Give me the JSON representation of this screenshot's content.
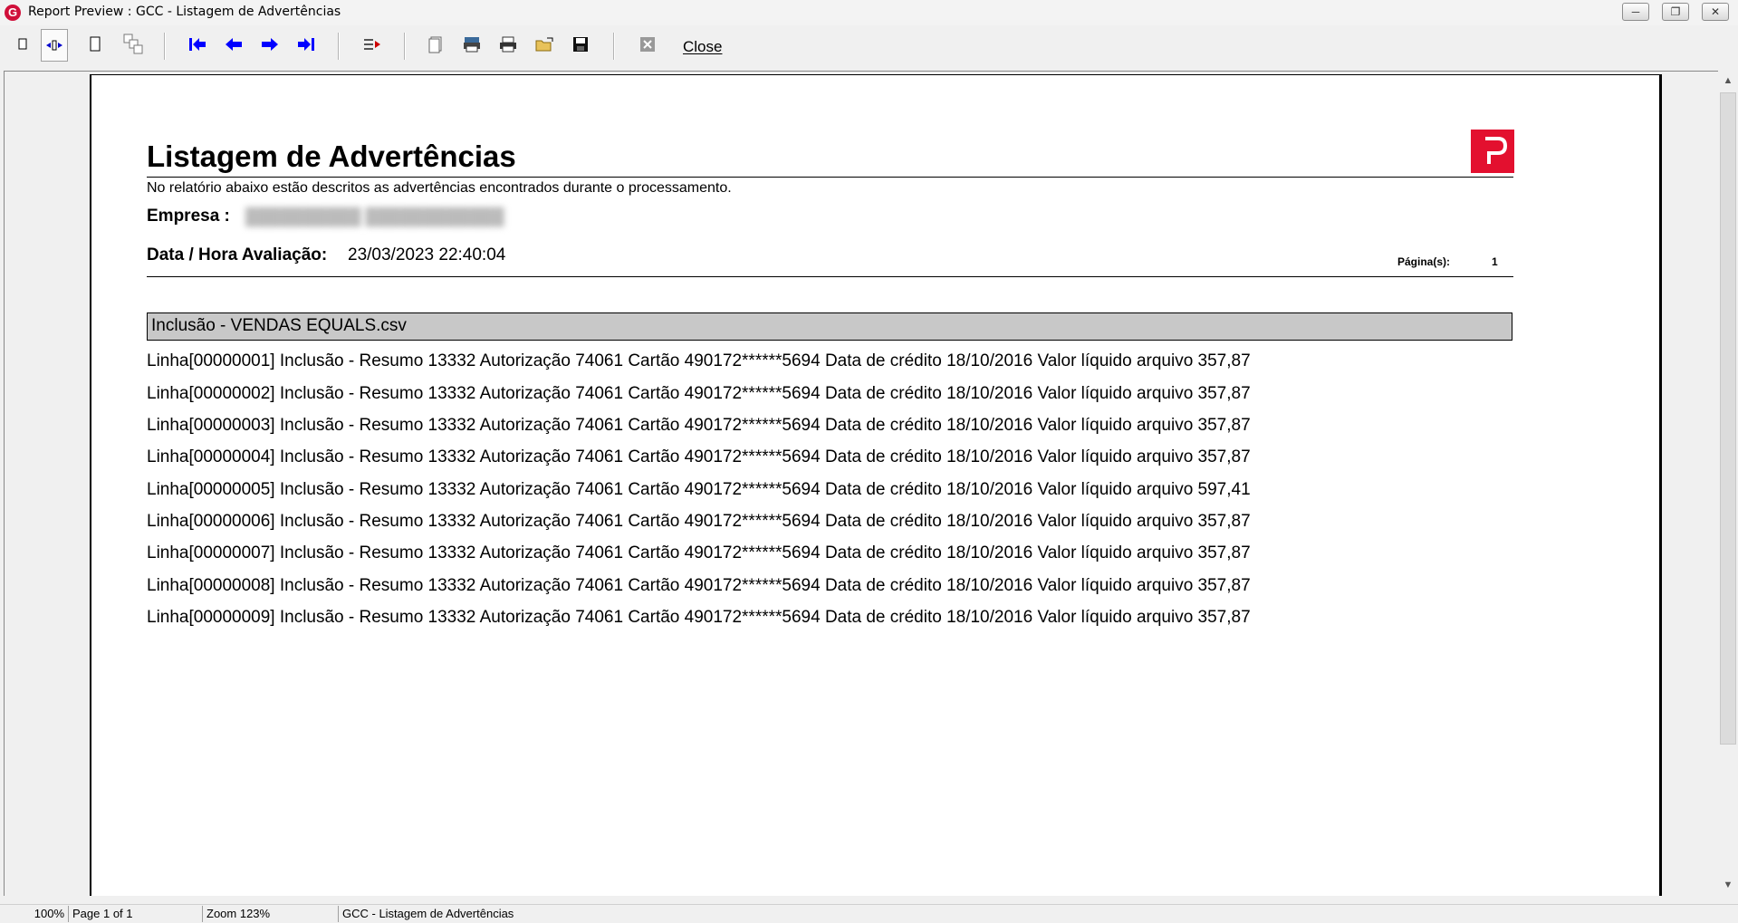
{
  "window": {
    "title": "Report Preview : GCC - Listagem de Advertências",
    "app_icon": "G"
  },
  "toolbar": {
    "buttons": [
      "zoom-to-fit-icon",
      "zoom-100-icon",
      "zoom-to-width-icon",
      "pages-icon",
      "first-page-icon",
      "previous-page-icon",
      "next-page-icon",
      "last-page-icon",
      "goto-page-icon",
      "page-setup-icon",
      "printer-setup-icon",
      "print-icon",
      "open-icon",
      "save-icon",
      "export-icon"
    ],
    "close_label": "Close",
    "nav_arrow_color": "#0000ff"
  },
  "report": {
    "title": "Listagem de Advertências",
    "subtitle": "No relatório abaixo estão descritos as advertências encontrados durante o processamento.",
    "empresa_label": "Empresa :",
    "empresa_value": "██████████ ████████████",
    "datahora_label": "Data / Hora Avaliação:",
    "datahora_value": "23/03/2023 22:40:04",
    "pagina_label": "Página(s):",
    "pagina_value": "1",
    "group_header": "Inclusão - VENDAS EQUALS.csv",
    "lines": [
      "Linha[00000001] Inclusão - Resumo 13332 Autorização 74061 Cartão 490172******5694 Data de crédito 18/10/2016 Valor líquido arquivo 357,87",
      "Linha[00000002] Inclusão - Resumo 13332 Autorização 74061 Cartão 490172******5694 Data de crédito 18/10/2016 Valor líquido arquivo 357,87",
      "Linha[00000003] Inclusão - Resumo 13332 Autorização 74061 Cartão 490172******5694 Data de crédito 18/10/2016 Valor líquido arquivo 357,87",
      "Linha[00000004] Inclusão - Resumo 13332 Autorização 74061 Cartão 490172******5694 Data de crédito 18/10/2016 Valor líquido arquivo 357,87",
      "Linha[00000005] Inclusão - Resumo 13332 Autorização 74061 Cartão 490172******5694 Data de crédito 18/10/2016 Valor líquido arquivo 597,41",
      "Linha[00000006] Inclusão - Resumo 13332 Autorização 74061 Cartão 490172******5694 Data de crédito 18/10/2016 Valor líquido arquivo 357,87",
      "Linha[00000007] Inclusão - Resumo 13332 Autorização 74061 Cartão 490172******5694 Data de crédito 18/10/2016 Valor líquido arquivo 357,87",
      "Linha[00000008] Inclusão - Resumo 13332 Autorização 74061 Cartão 490172******5694 Data de crédito 18/10/2016 Valor líquido arquivo 357,87",
      "Linha[00000009] Inclusão - Resumo 13332 Autorização 74061 Cartão 490172******5694 Data de crédito 18/10/2016 Valor líquido arquivo 357,87"
    ],
    "logo_color": "#e3102f"
  },
  "status": {
    "zoom_percent": "100%",
    "page": "Page 1 of 1",
    "zoom": "Zoom 123%",
    "doc_title": "GCC - Listagem de Advertências"
  }
}
